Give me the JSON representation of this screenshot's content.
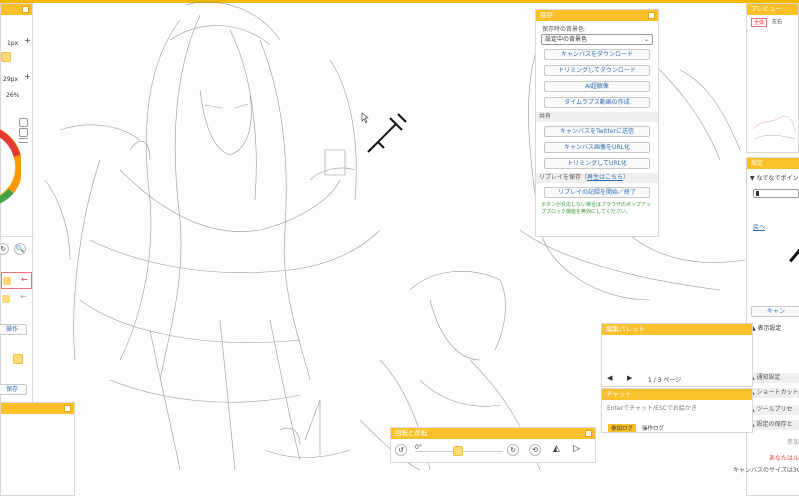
{
  "left_tools": {
    "brush_size": "1px",
    "second_size": "29px",
    "opacity": "26%",
    "op_label": "操作",
    "save_label": "保存"
  },
  "save_panel": {
    "title": "保存",
    "bg_label": "保存時の背景色:",
    "bg_select": "設定中の背景色",
    "buttons": [
      "キャンバスをダウンロード",
      "トリミングしてダウンロード",
      "AI超解像",
      "タイムラプス動画の作成"
    ],
    "share_title": "共有",
    "share_buttons": [
      "キャンバスをTwitterに送信",
      "キャンバス画像をURL化",
      "トリミングしてURL化"
    ],
    "replay_title": "リプレイを保存",
    "replay_link": "再生はこちら",
    "replay_button": "リプレイの記録を開始／終了",
    "note": "ボタンが反応しない場合はブラウザのポップアップブロック機能を無効にしてください。"
  },
  "preview_panel": {
    "title": "プレビュー",
    "tabs": [
      "全体",
      "左右"
    ]
  },
  "settings_panel": {
    "title": "設定",
    "section": "なでなでポイン",
    "link": "戻へ",
    "cancel_button": "キャン",
    "items": [
      "表示設定",
      "通知設定",
      "ショートカット",
      "ツールプリセ",
      "設定の保存と"
    ],
    "partial1": "参加",
    "partial2": "あなたはル",
    "partial3": "キャンバスのサイズは3C"
  },
  "edit_palette": {
    "title": "編集パレット",
    "page": "1 / 3 ページ"
  },
  "chat_panel": {
    "title": "チャット",
    "placeholder": "Enterでチャット/ESCでお絵かき",
    "tabs": [
      "参加ログ",
      "操作ログ"
    ]
  },
  "rotate_panel": {
    "title": "回転と反転",
    "angle": "0°"
  },
  "colors": {
    "accent": "#f9c02a",
    "link": "#2f6fb5"
  }
}
